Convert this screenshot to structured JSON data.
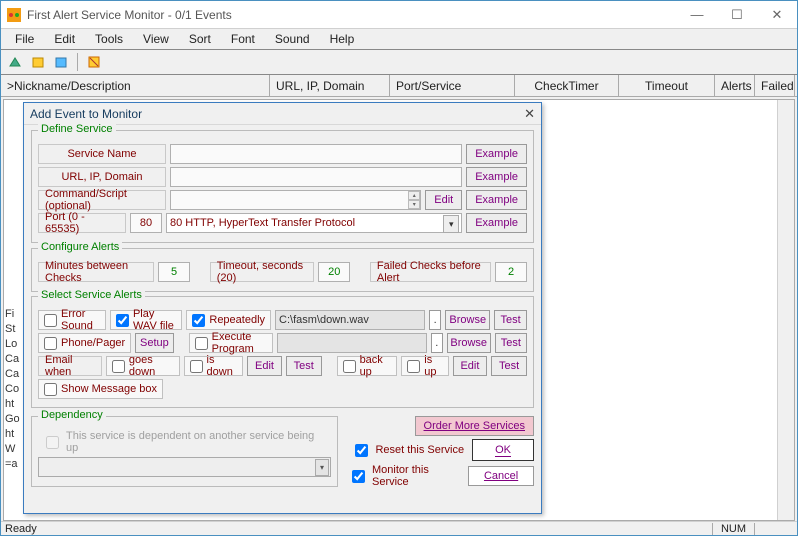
{
  "titlebar": {
    "text": "First Alert Service Monitor - 0/1 Events"
  },
  "menubar": [
    "File",
    "Edit",
    "Tools",
    "View",
    "Sort",
    "Font",
    "Sound",
    "Help"
  ],
  "columns": {
    "nickname": ">Nickname/Description",
    "url": "URL, IP, Domain",
    "port": "Port/Service",
    "checktimer": "CheckTimer",
    "timeout": "Timeout",
    "alerts": "Alerts",
    "failed": "Failed"
  },
  "sidetext": "Fi\nSt\nLo\nCa\nCa\nCo\nht\nGo\nht\nW\n=a",
  "status": {
    "ready": "Ready",
    "num": "NUM"
  },
  "dialog": {
    "title": "Add Event to Monitor",
    "define": {
      "legend": "Define Service",
      "service_name_label": "Service Name",
      "url_label": "URL, IP, Domain",
      "cmd_label": "Command/Script (optional)",
      "port_label": "Port (0 - 65535)",
      "port_value": "80",
      "port_desc": "80 HTTP, HyperText Transfer Protocol",
      "example": "Example",
      "edit": "Edit"
    },
    "configure": {
      "legend": "Configure Alerts",
      "minutes_label": "Minutes between Checks",
      "minutes_value": "5",
      "timeout_label": "Timeout, seconds (20)",
      "timeout_value": "20",
      "failed_label": "Failed Checks before Alert",
      "failed_value": "2"
    },
    "select": {
      "legend": "Select Service Alerts",
      "error_sound": "Error Sound",
      "play_wav": "Play WAV file",
      "repeatedly": "Repeatedly",
      "wav_path": "C:\\fasm\\down.wav",
      "browse": "Browse",
      "test": "Test",
      "phone": "Phone/Pager",
      "setup": "Setup",
      "exec": "Execute Program",
      "email_label": "Email when",
      "goes_down": "goes down",
      "is_down": "is down",
      "back_up": "back up",
      "is_up": "is up",
      "edit": "Edit",
      "show_msg": "Show Message box"
    },
    "dependency": {
      "legend": "Dependency",
      "text": "This service is dependent on another service being up"
    },
    "buttons": {
      "order": "Order More Services",
      "reset": "Reset this Service",
      "monitor": "Monitor this Service",
      "ok": "OK",
      "cancel": "Cancel"
    }
  }
}
